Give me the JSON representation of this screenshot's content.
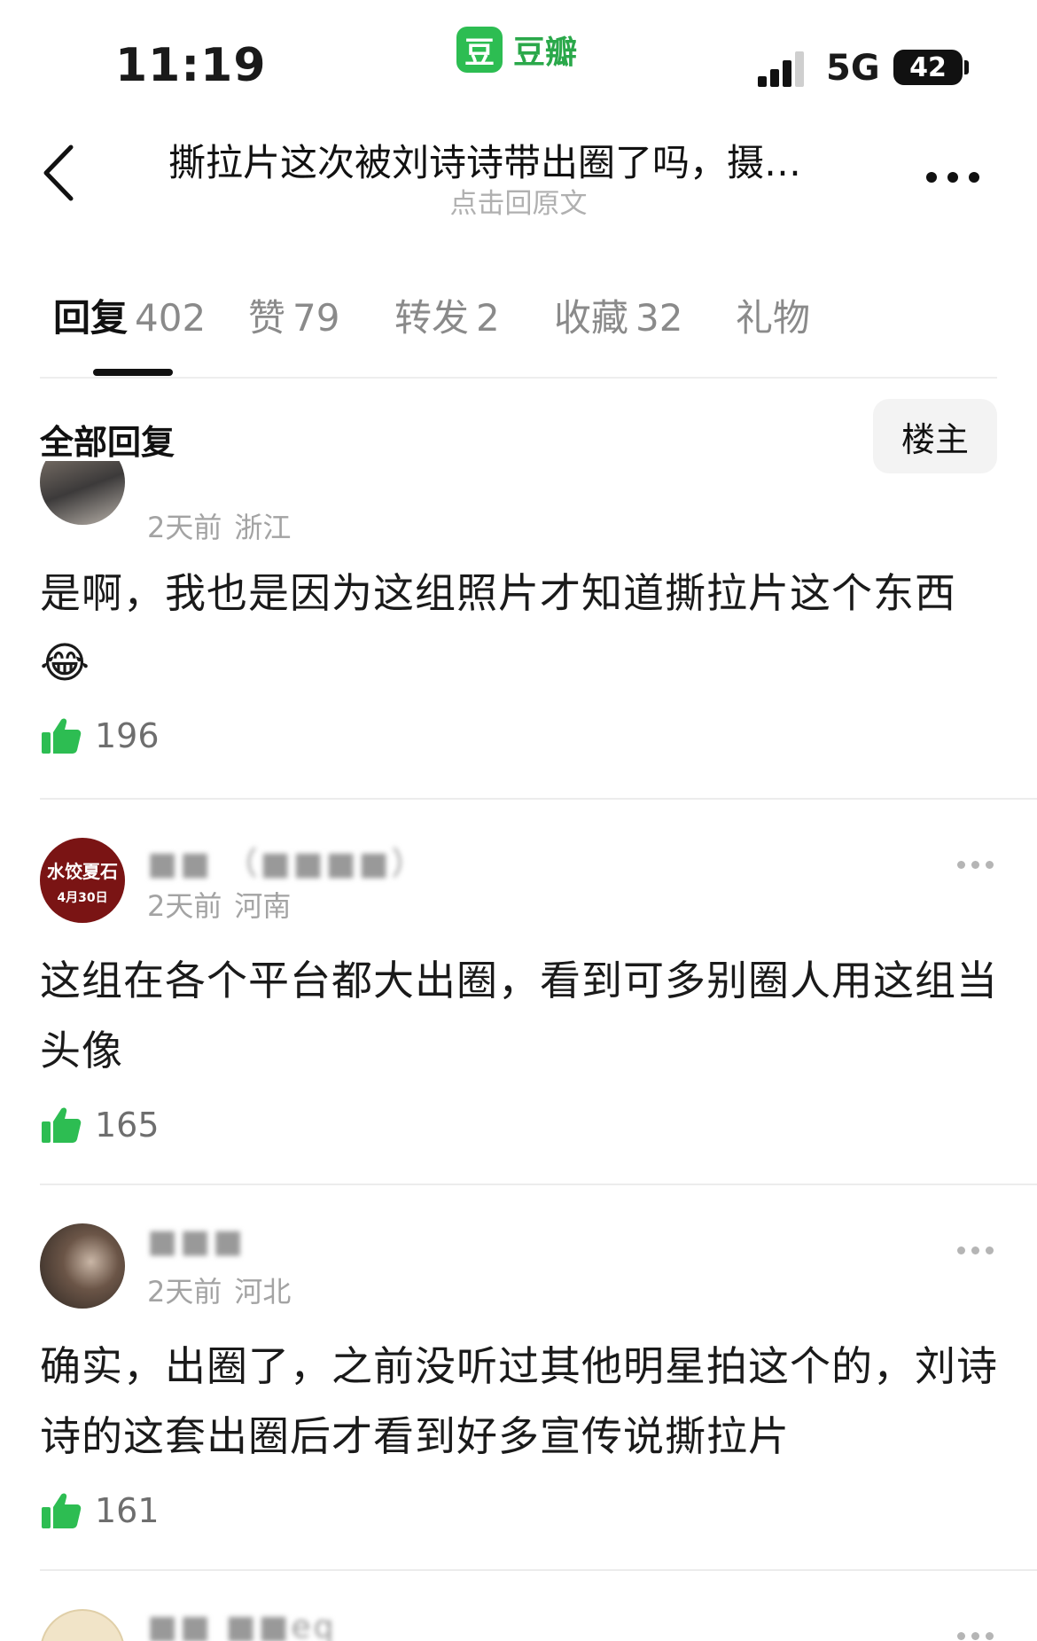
{
  "status_bar": {
    "time": "11:19",
    "app_logo_char": "豆",
    "app_name": "豆瓣",
    "network": "5G",
    "battery": "42"
  },
  "nav": {
    "title": "撕拉片这次被刘诗诗带出圈了吗，摄…",
    "subtitle": "点击回原文"
  },
  "tabs": [
    {
      "label": "回复",
      "count": "402"
    },
    {
      "label": "赞",
      "count": "79"
    },
    {
      "label": "转发",
      "count": "2"
    },
    {
      "label": "收藏",
      "count": "32"
    },
    {
      "label": "礼物",
      "count": ""
    }
  ],
  "section": {
    "title": "全部回复",
    "owner_filter": "楼主"
  },
  "comments": [
    {
      "username": "",
      "time": "2天前",
      "location": "浙江",
      "text": "是啊，我也是因为这组照片才知道撕拉片这个东西",
      "emoji": "😂",
      "likes": "196"
    },
    {
      "username": "■■ （■■■■）",
      "avatar_text": "水饺夏石",
      "avatar_date": "4月30日",
      "time": "2天前",
      "location": "河南",
      "text": "这组在各个平台都大出圈，看到可多别圈人用这组当头像",
      "likes": "165"
    },
    {
      "username": "■■■",
      "time": "2天前",
      "location": "河北",
      "text": "确实，出圈了，之前没听过其他明星拍这个的，刘诗诗的这套出圈后才看到好多宣传说撕拉片",
      "likes": "161"
    },
    {
      "username": "■■ ■■eq"
    }
  ],
  "colors": {
    "accent_green": "#2dbd52",
    "like_green": "#2dbd52",
    "text_gray": "#a3a3a3"
  }
}
